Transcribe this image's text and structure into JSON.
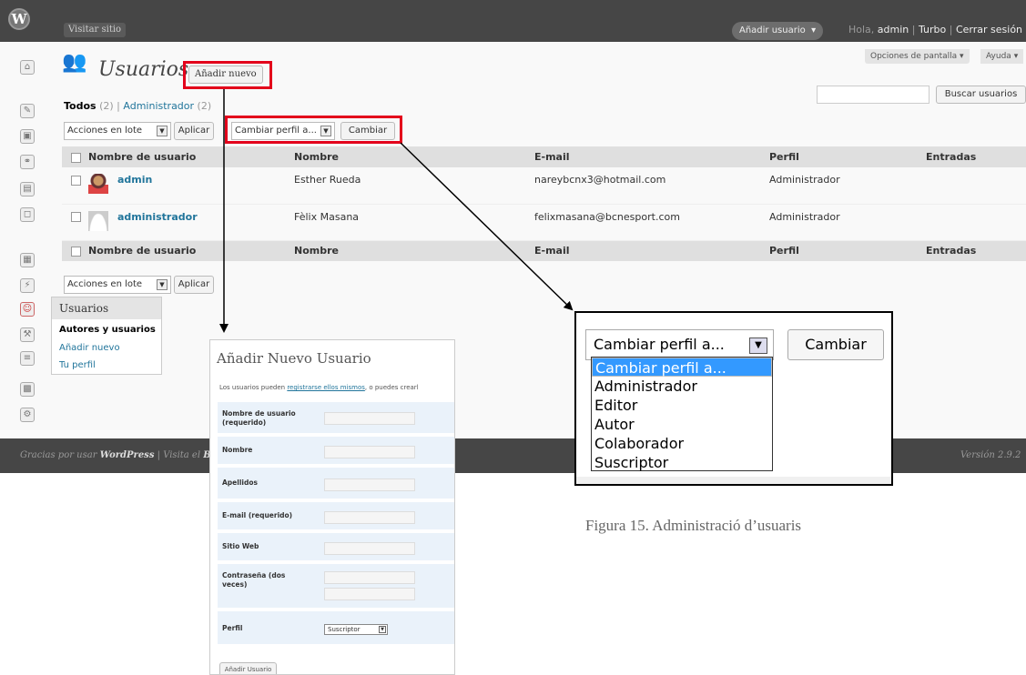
{
  "topbar": {
    "visit_site": "Visitar sitio",
    "add_user_fav": "Añadir usuario",
    "greeting_prefix": "Hola,",
    "username": "admin",
    "separator1": "|",
    "turbo": "Turbo",
    "separator2": "|",
    "logout": "Cerrar sesión"
  },
  "screen_options": "Opciones de pantalla",
  "help": "Ayuda",
  "page": {
    "title": "Usuarios",
    "add_new": "Añadir nuevo"
  },
  "filters": {
    "all": "Todos",
    "all_count": "(2)",
    "sep": "|",
    "admin": "Administrador",
    "admin_count": "(2)"
  },
  "search": {
    "button": "Buscar usuarios"
  },
  "bulk": {
    "select": "Acciones en lote",
    "apply": "Aplicar",
    "change_role": "Cambiar perfil a...",
    "change": "Cambiar"
  },
  "table": {
    "headers": [
      "Nombre de usuario",
      "Nombre",
      "E-mail",
      "Perfil",
      "Entradas"
    ],
    "rows": [
      {
        "username": "admin",
        "name": "Esther Rueda",
        "email": "nareybcnx3@hotmail.com",
        "role": "Administrador"
      },
      {
        "username": "administrador",
        "name": "Fèlix Masana",
        "email": "felixmasana@bcnesport.com",
        "role": "Administrador"
      }
    ]
  },
  "users_menu": {
    "header": "Usuarios",
    "items": [
      "Autores y usuarios",
      "Añadir nuevo",
      "Tu perfil"
    ]
  },
  "footer": {
    "text": "Gracias por usar",
    "brand": "WordPress",
    "sep": "| Visita el",
    "blog": "Bl",
    "version": "Versión 2.9.2"
  },
  "add_form": {
    "title": "Añadir Nuevo Usuario",
    "intro_prefix": "Los usuarios pueden",
    "intro_link": "registrarse ellos mismos",
    "intro_suffix": ", o puedes crearl",
    "fields": [
      "Nombre de usuario (requerido)",
      "Nombre",
      "Apellidos",
      "E-mail (requerido)",
      "Sitio Web",
      "Contraseña (dos veces)",
      "Perfil"
    ],
    "role_value": "Suscriptor",
    "submit": "Añadir Usuario"
  },
  "zoom": {
    "select": "Cambiar perfil a...",
    "button": "Cambiar",
    "options": [
      "Cambiar perfil a...",
      "Administrador",
      "Editor",
      "Autor",
      "Colaborador",
      "Suscriptor"
    ]
  },
  "caption": "Figura 15. Administració d’usuaris",
  "icons": [
    "wordpress-logo-icon",
    "dashboard-icon",
    "posts-icon",
    "media-icon",
    "links-icon",
    "pages-icon",
    "comments-icon",
    "appearance-icon",
    "plugins-icon",
    "users-icon",
    "tools-icon",
    "settings-icon"
  ]
}
